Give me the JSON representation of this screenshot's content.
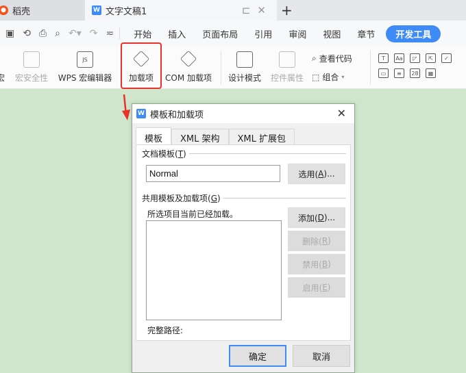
{
  "tabs": {
    "home_label": "稻壳",
    "doc_label": "文字文稿1",
    "doc_icon": "W",
    "new_tab": "+"
  },
  "quick_access": {
    "save": "🗎",
    "redo_format": "⤾",
    "print": "⎙",
    "preview": "🔍",
    "undo": "↶",
    "redo": "↷",
    "more": "≂"
  },
  "menu": {
    "items": [
      "开始",
      "插入",
      "页面布局",
      "引用",
      "审阅",
      "视图",
      "章节"
    ],
    "active": "开发工具"
  },
  "ribbon": {
    "macro_partial": "宏",
    "macro_security": "宏安全性",
    "wps_macro_editor": "WPS 宏编辑器",
    "js_badge": "JS",
    "addins": "加载项",
    "com_addins": "COM 加载项",
    "design_mode": "设计模式",
    "control_props": "控件属性",
    "view_code": "查看代码",
    "group": "组合",
    "control_glyphs": [
      "T",
      "Aa",
      "◸",
      "⇱",
      "✓",
      "▭",
      "≡",
      "28",
      "▦"
    ]
  },
  "dialog": {
    "title": "模板和加载项",
    "icon": "W",
    "close": "✕",
    "tabs": [
      "模板",
      "XML 架构",
      "XML 扩展包"
    ],
    "template_group": {
      "label": "文档模板(",
      "accel": "T",
      "suffix": ")"
    },
    "template_value": "Normal",
    "select_btn": {
      "label": "选用(",
      "accel": "A",
      "suffix": ")..."
    },
    "shared_group": {
      "label": "共用模板及加载项(",
      "accel": "G",
      "suffix": ")"
    },
    "loaded_note": "所选项目当前已经加载。",
    "add_btn": {
      "label": "添加(",
      "accel": "D",
      "suffix": ")..."
    },
    "delete_btn": {
      "label": "删除(",
      "accel": "R",
      "suffix": ")"
    },
    "disable_btn": {
      "label": "禁用(",
      "accel": "B",
      "suffix": ")"
    },
    "enable_btn": {
      "label": "启用(",
      "accel": "E",
      "suffix": ")"
    },
    "full_path_label": "完整路径:",
    "ok": "确定",
    "cancel": "取消"
  },
  "colors": {
    "accent": "#3e8af7",
    "highlight": "#e8312a",
    "canvas": "#cfe6cc"
  }
}
